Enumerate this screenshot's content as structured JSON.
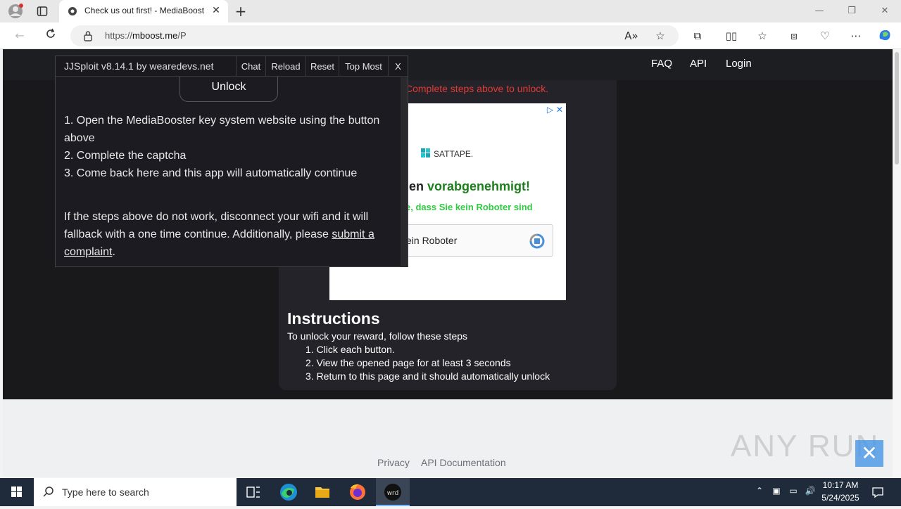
{
  "browser": {
    "tab_title": "Check us out first! - MediaBooster",
    "url_prefix": "https://",
    "url_host": "mboost.me",
    "url_path": "/P"
  },
  "site": {
    "nav": {
      "faq": "FAQ",
      "api": "API",
      "login": "Login"
    },
    "complete_message": "Complete steps above to unlock.",
    "ad": {
      "brand": "SATTAPE.",
      "headline_prefix": "len ",
      "headline_green": "vorabgenehmigt!",
      "subline": "e, dass Sie kein Roboter sind",
      "captcha_text": "ein Roboter"
    },
    "instructions": {
      "title": "Instructions",
      "subtitle": "To unlock your reward, follow these steps",
      "steps": [
        "1. Click each button.",
        "2. View the opened page for at least 3 seconds",
        "3. Return to this page and it should automatically unlock"
      ]
    },
    "footer": {
      "privacy": "Privacy",
      "api_docs": "API Documentation"
    }
  },
  "jjsploit": {
    "title": "JJSploit v8.14.1 by wearedevs.net",
    "buttons": {
      "chat": "Chat",
      "reload": "Reload",
      "reset": "Reset",
      "top_most": "Top Most",
      "close": "X"
    },
    "unlock": "Unlock",
    "steps": [
      "1. Open the MediaBooster key system website using the button above",
      "2. Complete the captcha",
      "3. Come back here and this app will automatically continue"
    ],
    "fallback_text": "If the steps above do not work, disconnect your wifi and it will fallback with a one time continue. Additionally, please ",
    "complaint_link": "submit a complaint",
    "fallback_end": "."
  },
  "watermark": {
    "text": "ANY RUN"
  },
  "taskbar": {
    "search_placeholder": "Type here to search",
    "time": "10:17 AM",
    "date": "5/24/2025"
  },
  "colors": {
    "site_dark": "#19191c",
    "card": "#232329",
    "error_red": "#e53935",
    "ad_green": "#1b7f1b"
  }
}
